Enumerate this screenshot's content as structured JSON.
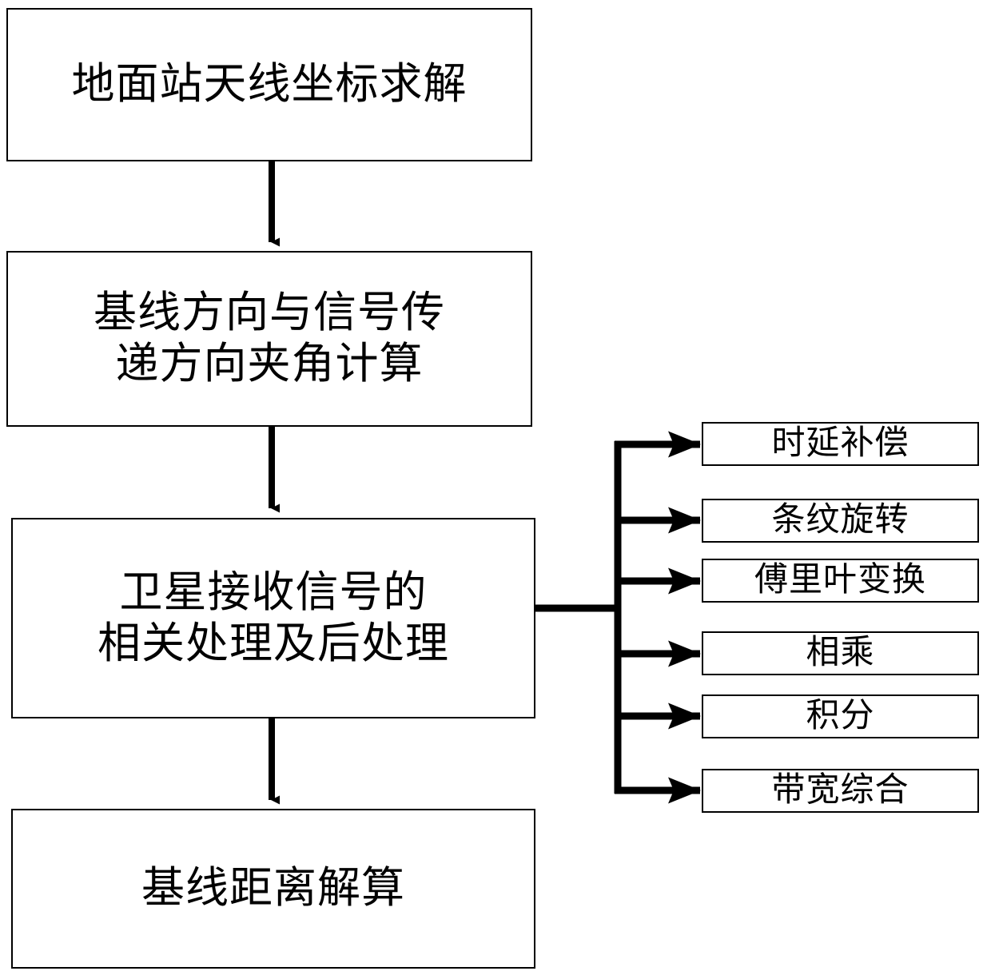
{
  "diagram": {
    "title": "",
    "colors": {
      "stroke": "#000000",
      "background": "#ffffff",
      "text": "#000000"
    },
    "main_flow": [
      {
        "id": "node-1",
        "label": "地面站天线坐标求解"
      },
      {
        "id": "node-2",
        "label": "基线方向与信号传\n递方向夹角计算"
      },
      {
        "id": "node-3",
        "label": "卫星接收信号的\n相关处理及后处理"
      },
      {
        "id": "node-4",
        "label": "基线距离解算"
      }
    ],
    "sub_steps": [
      {
        "id": "sub-1",
        "label": "时延补偿"
      },
      {
        "id": "sub-2",
        "label": "条纹旋转"
      },
      {
        "id": "sub-3",
        "label": "傅里叶变换"
      },
      {
        "id": "sub-4",
        "label": "相乘"
      },
      {
        "id": "sub-5",
        "label": "积分"
      },
      {
        "id": "sub-6",
        "label": "带宽综合"
      }
    ]
  }
}
